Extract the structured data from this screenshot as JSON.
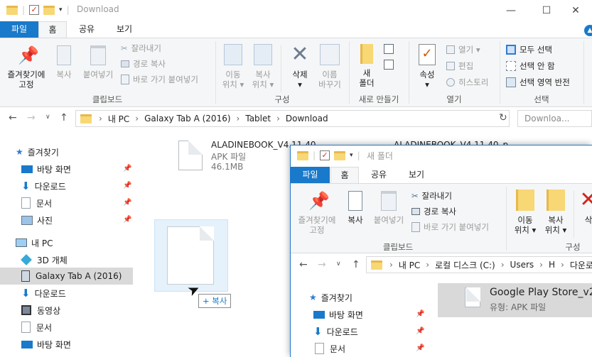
{
  "back_window": {
    "title": "Download",
    "tabs": [
      "파일",
      "홈",
      "공유",
      "보기"
    ],
    "ribbon": {
      "clipboard": {
        "pin_label": "즐겨찾기에\n고정",
        "copy_label": "복사",
        "paste_label": "붙여넣기",
        "cut_label": "잘라내기",
        "copy_path_label": "경로 복사",
        "paste_shortcut_label": "바로 가기 붙여넣기",
        "group_label": "클립보드"
      },
      "organize": {
        "move_label": "이동\n위치 ▾",
        "copyto_label": "복사\n위치 ▾",
        "delete_label": "삭제\n▾",
        "rename_label": "이름\n바꾸기",
        "group_label": "구성"
      },
      "new": {
        "new_folder_label": "새\n폴더",
        "group_label": "새로 만들기"
      },
      "open": {
        "props_label": "속성\n▾",
        "open_label": "열기 ▾",
        "edit_label": "편집",
        "history_label": "히스토리",
        "group_label": "열기"
      },
      "select": {
        "all_label": "모두 선택",
        "none_label": "선택 안 함",
        "invert_label": "선택 영역 반전",
        "group_label": "선택"
      }
    },
    "address": {
      "crumbs": [
        "내 PC",
        "Galaxy Tab A (2016)",
        "Tablet",
        "Download"
      ],
      "search_placeholder": "Downloa..."
    },
    "sidebar": [
      {
        "label": "즐겨찾기",
        "icon": "star-icon"
      },
      {
        "label": "바탕 화면",
        "icon": "desktop-icon"
      },
      {
        "label": "다운로드",
        "icon": "download-arrow-icon"
      },
      {
        "label": "문서",
        "icon": "document-icon"
      },
      {
        "label": "사진",
        "icon": "picture-icon"
      },
      {
        "label": "내 PC",
        "icon": "computer-icon"
      },
      {
        "label": "3D 개체",
        "icon": "cube-icon"
      },
      {
        "label": "Galaxy Tab A (2016)",
        "icon": "device-icon"
      },
      {
        "label": "다운로드",
        "icon": "download-arrow-icon"
      },
      {
        "label": "동영상",
        "icon": "video-icon"
      },
      {
        "label": "문서",
        "icon": "document-icon"
      },
      {
        "label": "바탕 화면",
        "icon": "desktop-icon"
      }
    ],
    "files": [
      {
        "name": "ALADINEBOOK_V4.11.40...",
        "type": "APK 파일",
        "size": "46.1MB"
      },
      {
        "name": "ALADINEBOOK_V4.11.40_p..."
      }
    ],
    "drag_badge": "+ 복사"
  },
  "front_window": {
    "title": "새 폴더",
    "tabs": [
      "파일",
      "홈",
      "공유",
      "보기"
    ],
    "ribbon": {
      "pin_label": "즐겨찾기에\n고정",
      "copy_label": "복사",
      "paste_label": "붙여넣기",
      "cut_label": "잘라내기",
      "copy_path_label": "경로 복사",
      "paste_shortcut_label": "바로 가기 붙여넣기",
      "clipboard_group": "클립보드",
      "move_label": "이동\n위치 ▾",
      "copyto_label": "복사\n위치 ▾",
      "delete_label": "삭",
      "organize_group": "구성"
    },
    "address": {
      "crumbs": [
        "내 PC",
        "로컬 디스크 (C:)",
        "Users",
        "H",
        "다운로"
      ]
    },
    "sidebar": [
      {
        "label": "즐겨찾기"
      },
      {
        "label": "바탕 화면"
      },
      {
        "label": "다운로드"
      },
      {
        "label": "문서"
      }
    ],
    "file": {
      "name": "Google Play Store_v2",
      "type": "유형: APK 파일"
    }
  }
}
